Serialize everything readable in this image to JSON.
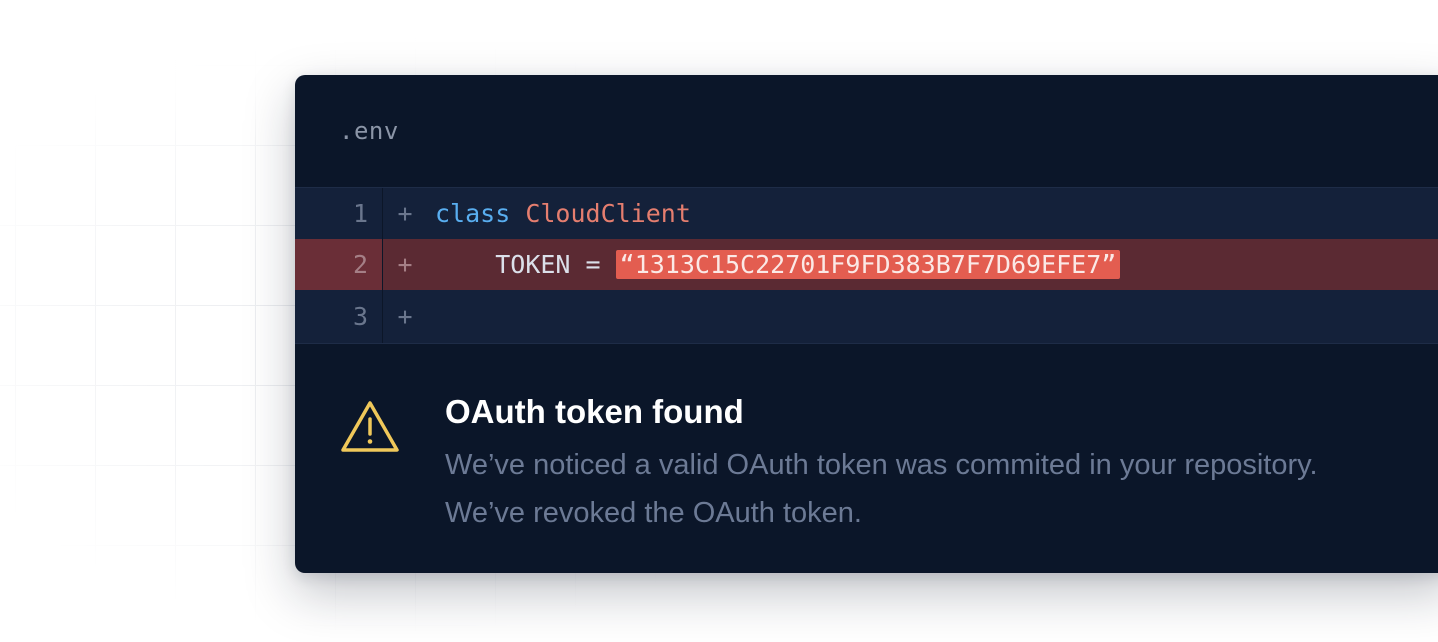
{
  "file": {
    "name": ".env"
  },
  "code": {
    "lines": [
      {
        "number": "1",
        "marker": "+",
        "keyword": "class",
        "class_name": "CloudClient"
      },
      {
        "number": "2",
        "marker": "+",
        "indent": "    ",
        "variable": "TOKEN",
        "operator": " = ",
        "secret": "“1313C15C22701F9FD383B7F7D69EFE7”"
      },
      {
        "number": "3",
        "marker": "+"
      }
    ]
  },
  "alert": {
    "icon": "warning-triangle-icon",
    "title": "OAuth token found",
    "line1": "We’ve noticed a valid OAuth token was commited in your repository.",
    "line2": "We’ve revoked the OAuth token."
  },
  "colors": {
    "card_background": "#0b1629",
    "keyword": "#59aef0",
    "class_name": "#e57e6f",
    "secret_highlight": "#e35d50",
    "warning": "#f0c85a"
  }
}
